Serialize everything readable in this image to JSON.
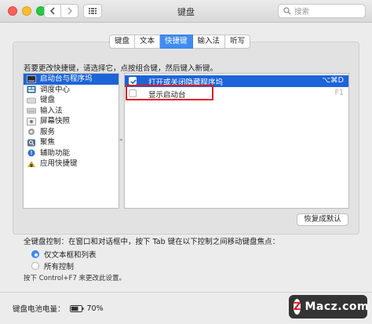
{
  "window": {
    "title": "键盘"
  },
  "search": {
    "placeholder": "搜索"
  },
  "tabs": [
    {
      "label": "键盘",
      "active": false
    },
    {
      "label": "文本",
      "active": false
    },
    {
      "label": "快捷键",
      "active": true
    },
    {
      "label": "输入法",
      "active": false
    },
    {
      "label": "听写",
      "active": false
    }
  ],
  "instruction": "若要更改快捷键，请选择它，点按组合键，然后键入新键。",
  "categories": [
    {
      "label": "启动台与程序坞",
      "icon": "dock-icon",
      "selected": true
    },
    {
      "label": "调度中心",
      "icon": "mission-control-icon",
      "selected": false
    },
    {
      "label": "键盘",
      "icon": "keyboard-icon",
      "selected": false
    },
    {
      "label": "输入法",
      "icon": "input-method-icon",
      "selected": false
    },
    {
      "label": "屏幕快照",
      "icon": "screenshot-icon",
      "selected": false
    },
    {
      "label": "服务",
      "icon": "gear-icon",
      "selected": false
    },
    {
      "label": "聚焦",
      "icon": "spotlight-icon",
      "selected": false
    },
    {
      "label": "辅助功能",
      "icon": "accessibility-icon",
      "selected": false
    },
    {
      "label": "应用快捷键",
      "icon": "app-shortcuts-icon",
      "selected": false
    }
  ],
  "shortcuts": [
    {
      "label": "打开或关闭隐藏程序坞",
      "key": "⌥⌘D",
      "checked": true,
      "selected": true
    },
    {
      "label": "显示启动台",
      "key": "F1",
      "checked": false,
      "selected": false
    }
  ],
  "restore_button": "恢复成默认",
  "full_keyboard_control": "全键盘控制：在窗口和对话框中，按下 Tab 键在以下控制之间移动键盘焦点：",
  "radio_options": [
    {
      "label": "仅文本框和列表",
      "selected": true
    },
    {
      "label": "所有控制",
      "selected": false
    }
  ],
  "hint": "按下 Control+F7 来更改此设置。",
  "battery": {
    "label": "键盘电池电量：",
    "value": "70%",
    "level": 0.7
  },
  "watermark": {
    "text": "Macz.com",
    "logo": "Z"
  },
  "colors": {
    "accent": "#3f8cf1",
    "selection": "#1d64d8",
    "highlight_box": "#e01b24"
  }
}
